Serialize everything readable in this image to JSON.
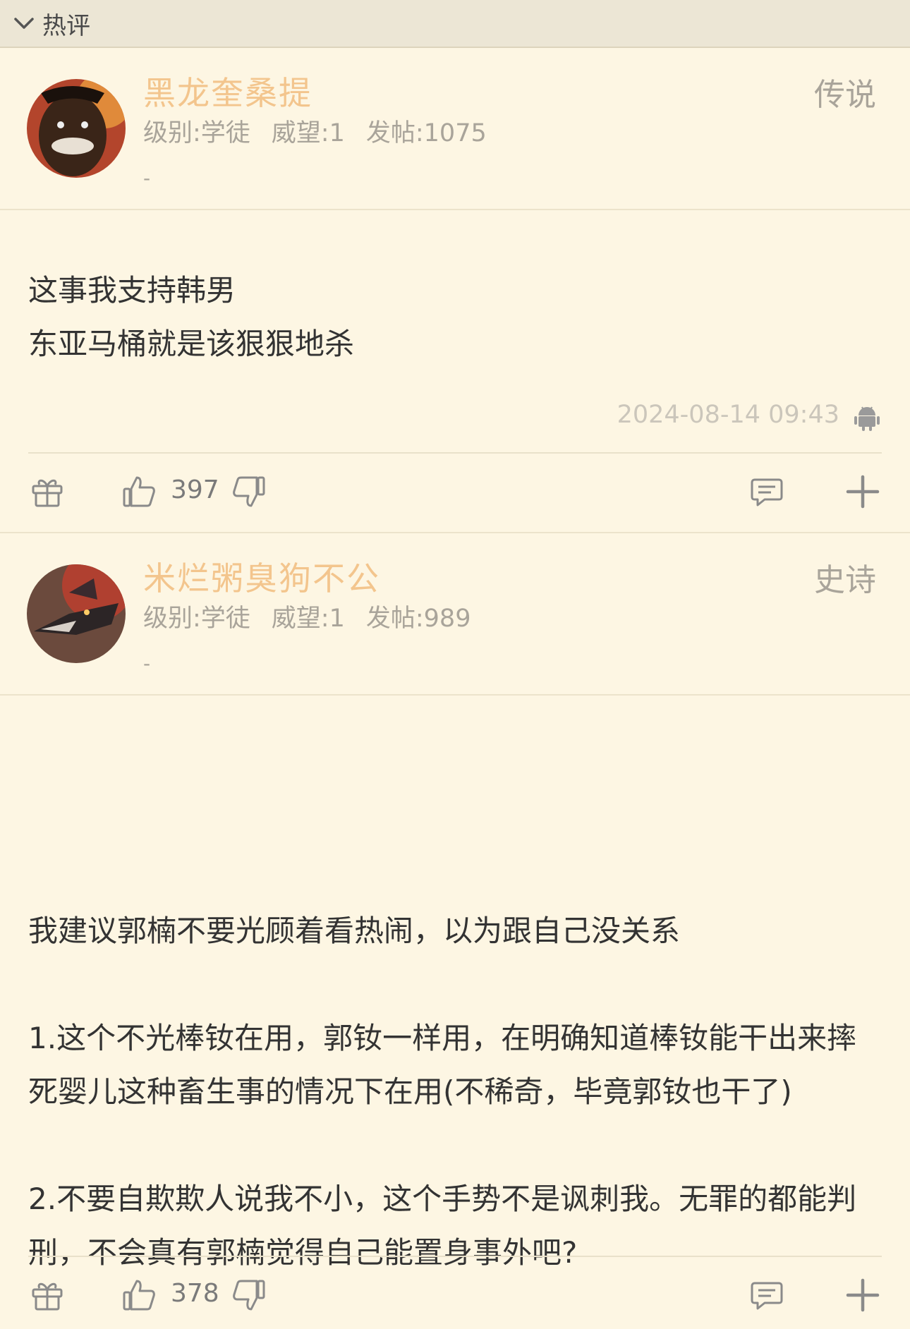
{
  "section": {
    "title": "热评"
  },
  "posts": [
    {
      "username": "黑龙奎桑提",
      "rank": "传说",
      "level": "级别:学徒",
      "prestige": "威望:1",
      "posts_count": "发帖:1075",
      "signature": "-",
      "content_lines": [
        "这事我支持韩男",
        "东亚马桶就是该狠狠地杀"
      ],
      "timestamp": "2024-08-14 09:43",
      "likes": "397"
    },
    {
      "username": "米烂粥臭狗不公",
      "rank": "史诗",
      "level": "级别:学徒",
      "prestige": "威望:1",
      "posts_count": "发帖:989",
      "signature": "-",
      "content_lines": [
        "我建议郭楠不要光顾着看热闹，以为跟自己没关系",
        "",
        "1.这个不光棒钕在用，郭钕一样用，在明确知道棒钕能干出来摔死婴儿这种畜生事的情况下在用(不稀奇，毕竟郭钕也干了)",
        "",
        "2.不要自欺欺人说我不小，这个手势不是讽刺我。无罪的都能判刑，不会真有郭楠觉得自己能置身事外吧?"
      ],
      "likes": "378"
    }
  ],
  "colors": {
    "background": "#fdf6e3",
    "header_bg": "#ece6d5",
    "username": "#f3c58d",
    "meta": "#a9a49a",
    "icon": "#8a8a8a"
  },
  "icons": [
    "chevron-down-icon",
    "gift-icon",
    "thumbs-up-icon",
    "thumbs-down-icon",
    "comment-icon",
    "plus-icon",
    "android-icon"
  ]
}
